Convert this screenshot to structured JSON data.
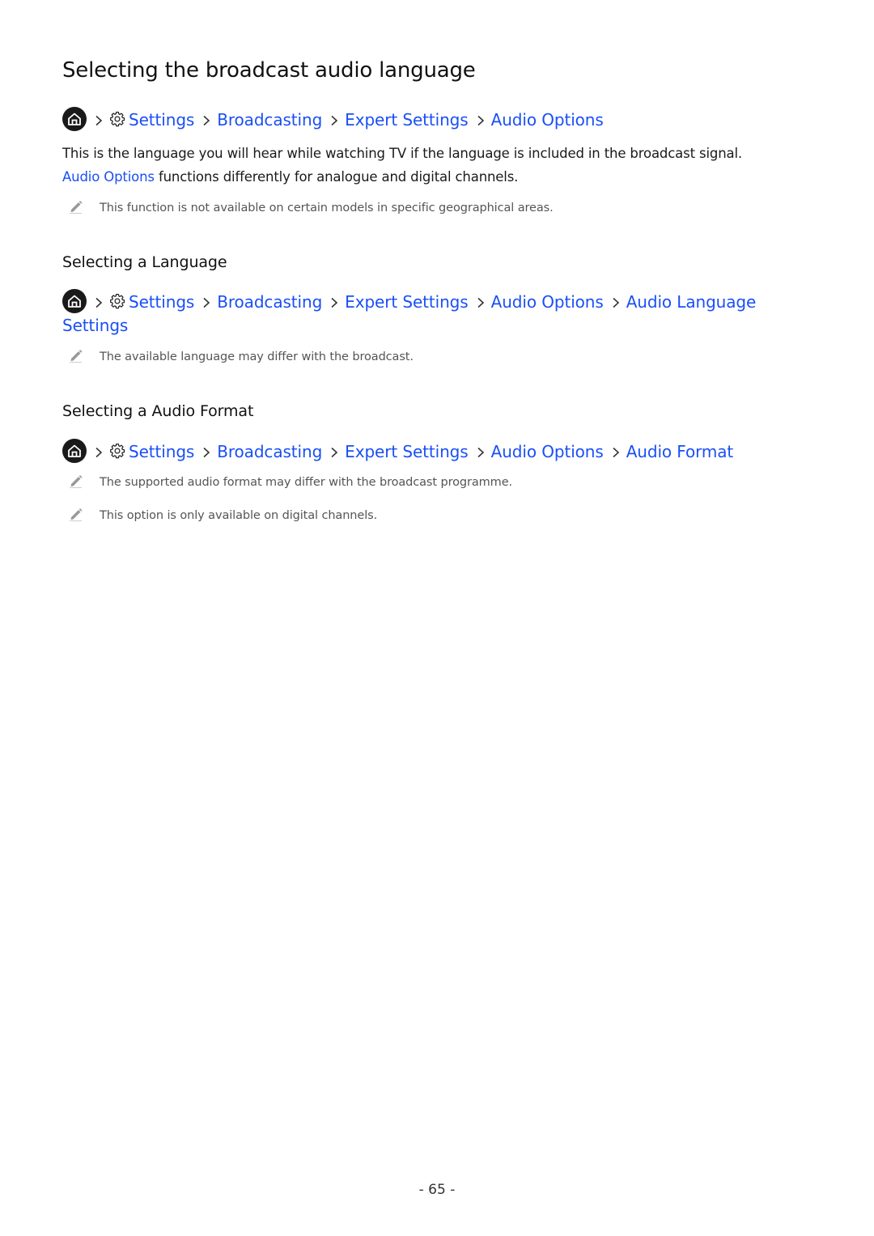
{
  "page_title": "Selecting the broadcast audio language",
  "colors": {
    "link": "#1a4ff5",
    "text": "#1a1a1a",
    "note_text": "#555555",
    "home_icon_bg": "#1a1a1a"
  },
  "intro_path": {
    "icons": [
      "home-icon",
      "gear-icon"
    ],
    "items": [
      "Settings",
      "Broadcasting",
      "Expert Settings",
      "Audio Options"
    ]
  },
  "intro_paragraph": {
    "text_before": "This is the language you will hear while watching TV if the language is included in the broadcast signal. ",
    "link": "Audio Options",
    "text_after": " functions differently for analogue and digital channels."
  },
  "intro_notes": [
    "This function is not available on certain models in specific geographical areas."
  ],
  "sections": [
    {
      "heading": "Selecting a Language",
      "path": {
        "icons": [
          "home-icon",
          "gear-icon"
        ],
        "items": [
          "Settings",
          "Broadcasting",
          "Expert Settings",
          "Audio Options",
          "Audio Language Settings"
        ]
      },
      "notes": [
        "The available language may differ with the broadcast."
      ]
    },
    {
      "heading": "Selecting a Audio Format",
      "path": {
        "icons": [
          "home-icon",
          "gear-icon"
        ],
        "items": [
          "Settings",
          "Broadcasting",
          "Expert Settings",
          "Audio Options",
          "Audio Format"
        ]
      },
      "notes": [
        "The supported audio format may differ with the broadcast programme.",
        "This option is only available on digital channels."
      ]
    }
  ],
  "page_number": "- 65 -"
}
